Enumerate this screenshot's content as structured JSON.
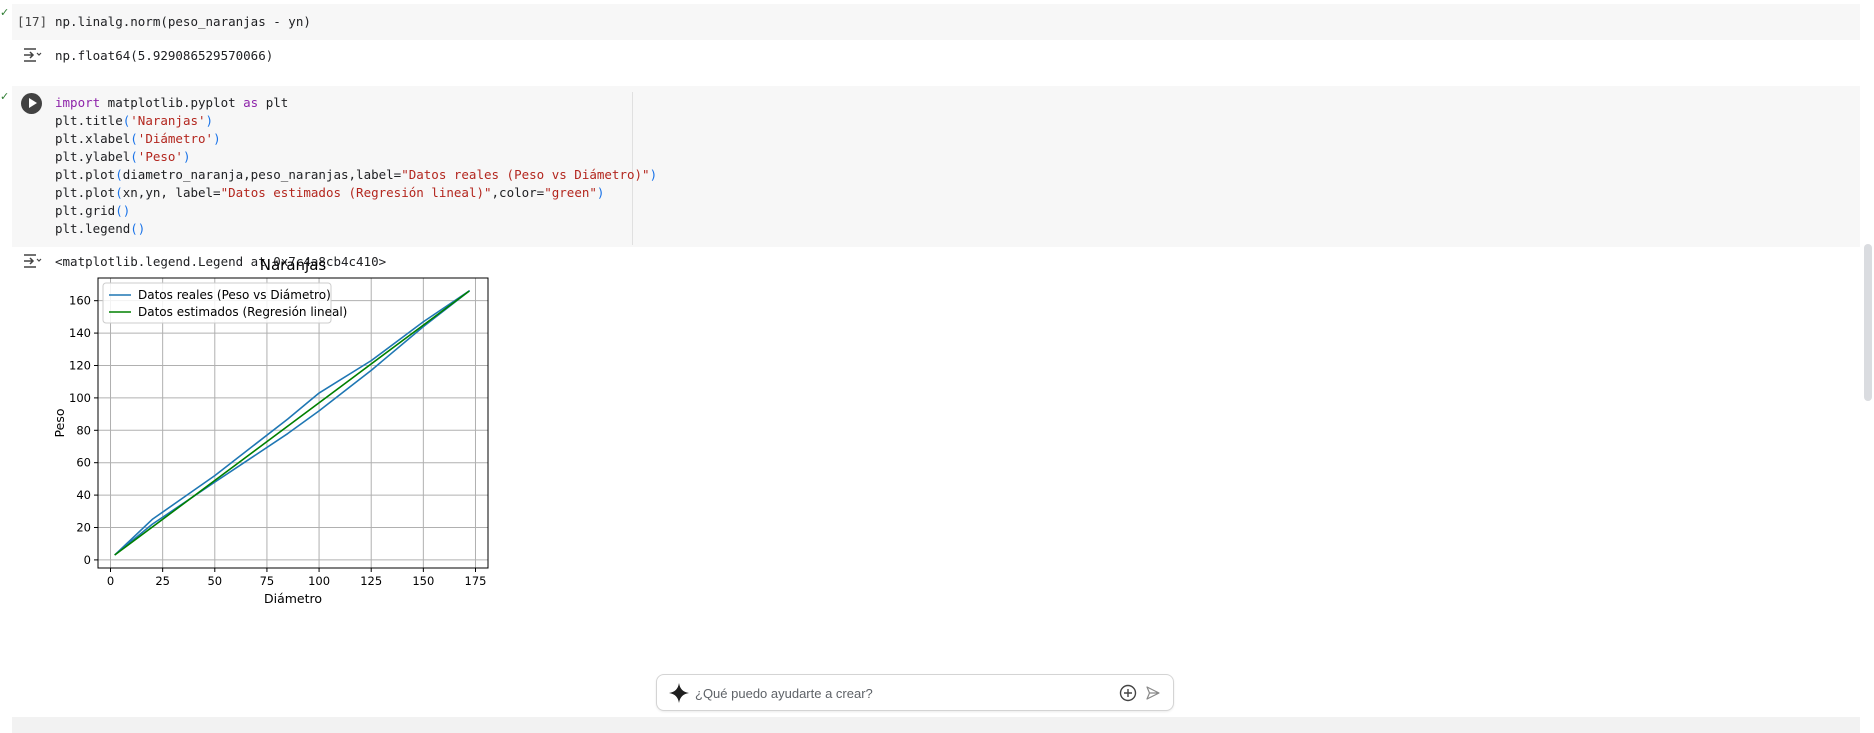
{
  "cells": [
    {
      "exec_count": "[17]",
      "code": "np.linalg.norm(peso_naranjas - yn)",
      "output": "np.float64(5.929086529570066)"
    },
    {
      "code_lines": [
        {
          "kw": "import",
          "rest1": " matplotlib.pyplot ",
          "kw2": "as",
          "rest2": " plt"
        },
        {
          "pre": "plt.title",
          "op": "(",
          "str": "'Naranjas'",
          "cl": ")"
        },
        {
          "pre": "plt.xlabel",
          "op": "(",
          "str": "'Diámetro'",
          "cl": ")"
        },
        {
          "pre": "plt.ylabel",
          "op": "(",
          "str": "'Peso'",
          "cl": ")"
        },
        {
          "pre": "plt.plot",
          "op": "(",
          "mid": "diametro_naranja,peso_naranjas,label=",
          "str": "\"Datos reales (Peso vs Diámetro)\"",
          "cl": ")"
        },
        {
          "pre": "plt.plot",
          "op": "(",
          "mid": "xn,yn, label=",
          "str": "\"Datos estimados (Regresión lineal)\"",
          "mid2": ",color=",
          "str2": "\"green\"",
          "cl": ")"
        },
        {
          "pre": "plt.grid",
          "op": "(",
          "cl": ")"
        },
        {
          "pre": "plt.legend",
          "op": "(",
          "cl": ")"
        }
      ],
      "output": "<matplotlib.legend.Legend at 0x7c4a8cb4c410>"
    }
  ],
  "chart_data": {
    "type": "line",
    "title": "Naranjas",
    "xlabel": "Diámetro",
    "ylabel": "Peso",
    "xlim": [
      -6,
      181
    ],
    "ylim": [
      -5,
      174
    ],
    "xticks": [
      0,
      25,
      50,
      75,
      100,
      125,
      150,
      175
    ],
    "yticks": [
      0,
      20,
      40,
      60,
      80,
      100,
      120,
      140,
      160
    ],
    "grid": true,
    "legend_position": "upper-left",
    "series": [
      {
        "name": "Datos reales (Peso vs Diámetro)",
        "color": "#1f77b4",
        "x": [
          2,
          20,
          50,
          85,
          100,
          125,
          150,
          172,
          150,
          125,
          100,
          85,
          50,
          20,
          2
        ],
        "y": [
          3,
          25,
          52,
          87,
          103,
          123,
          147,
          166,
          144,
          117,
          92,
          78,
          48,
          22,
          3
        ]
      },
      {
        "name": "Datos estimados (Regresión lineal)",
        "color": "#008000",
        "x": [
          2,
          172
        ],
        "y": [
          3,
          166
        ]
      }
    ]
  },
  "prompt": {
    "placeholder": "¿Qué puedo ayudarte a crear?"
  }
}
